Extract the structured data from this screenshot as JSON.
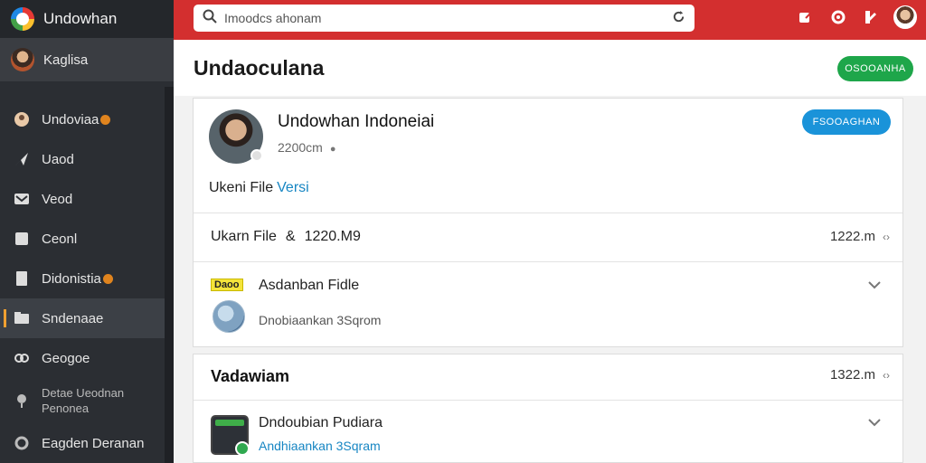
{
  "sidebar": {
    "brand": "Undowhan",
    "account": "Kaglisa",
    "items": [
      {
        "label": "Undoviaa",
        "icon": "user-icon",
        "badge": true
      },
      {
        "label": "Uaod",
        "icon": "send-icon",
        "badge": false
      },
      {
        "label": "Veod",
        "icon": "inbox-icon",
        "badge": false
      },
      {
        "label": "Ceonl",
        "icon": "square-icon",
        "badge": false
      },
      {
        "label": "Didonistia",
        "icon": "file-icon",
        "badge": true
      },
      {
        "label": "Sndenaae",
        "icon": "folder-icon",
        "badge": false,
        "active": true
      },
      {
        "label": "Geogoe",
        "icon": "link-icon",
        "badge": false
      }
    ],
    "item_two_line": {
      "line1": "Detae Ueodnan",
      "line2": "Penonea"
    },
    "item_last": "Eagden Deranan"
  },
  "topbar": {
    "search_value": "Imoodcs ahonam"
  },
  "header": {
    "title": "Undaoculana",
    "button_label": "OSOOANHA"
  },
  "profile": {
    "name": "Undowhan Indoneiai",
    "sub": "2200cm",
    "button_label": "FSOOAGHAN",
    "file_text": "Ukeni File",
    "file_link": "Versi"
  },
  "row1": {
    "label": "Ukarn File",
    "amp": "&",
    "value": "1220.M9",
    "meta": "1222.m"
  },
  "row2": {
    "tag": "Daoo",
    "title": "Asdanban Fidle",
    "sub": "Dnobiaankan 3Sqrom"
  },
  "card2": {
    "title": "Vadawiam",
    "meta": "1322.m",
    "item_title": "Dndoubian Pudiara",
    "item_sub": "Andhiaankan 3Sqram"
  },
  "colors": {
    "topbar": "#d32f2f",
    "sidebar": "#2b2e33",
    "green_button": "#1ea64a",
    "blue_button": "#1a93d9",
    "link": "#1786c3"
  }
}
